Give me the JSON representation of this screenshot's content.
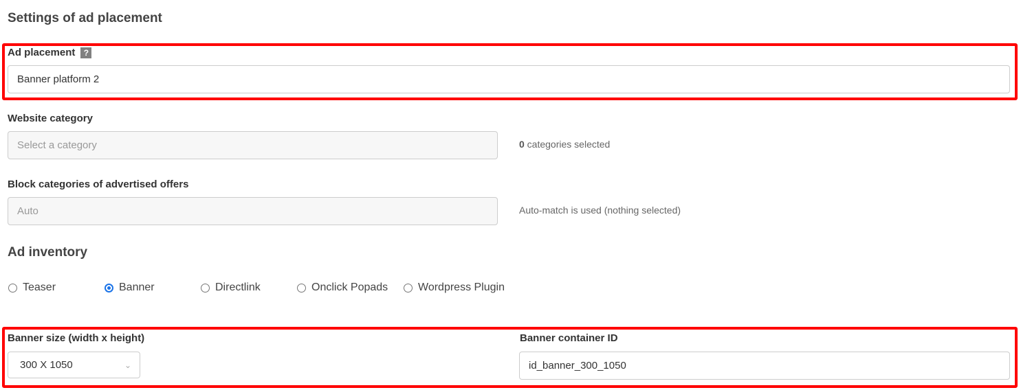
{
  "page": {
    "title": "Settings of ad placement"
  },
  "ad_placement": {
    "label": "Ad placement",
    "help_icon": "question-mark-icon",
    "help_glyph": "?",
    "value": "Banner platform 2"
  },
  "website_category": {
    "label": "Website category",
    "placeholder": "Select a category",
    "count": "0",
    "count_suffix": " categories selected"
  },
  "block_categories": {
    "label": "Block categories of advertised offers",
    "placeholder": "Auto",
    "hint": "Auto-match is used (nothing selected)"
  },
  "ad_inventory": {
    "title": "Ad inventory",
    "options": [
      {
        "label": "Teaser",
        "checked": false
      },
      {
        "label": "Banner",
        "checked": true
      },
      {
        "label": "Directlink",
        "checked": false
      },
      {
        "label": "Onclick Popads",
        "checked": false
      },
      {
        "label": "Wordpress Plugin",
        "checked": false
      }
    ]
  },
  "banner_size": {
    "label": "Banner size (width x height)",
    "value": "300 X 1050",
    "chevron": "chevron-down-icon"
  },
  "banner_container": {
    "label": "Banner container ID",
    "value": "id_banner_300_1050"
  },
  "highlight_color": "#ff0000",
  "accent_color": "#1a73e8"
}
